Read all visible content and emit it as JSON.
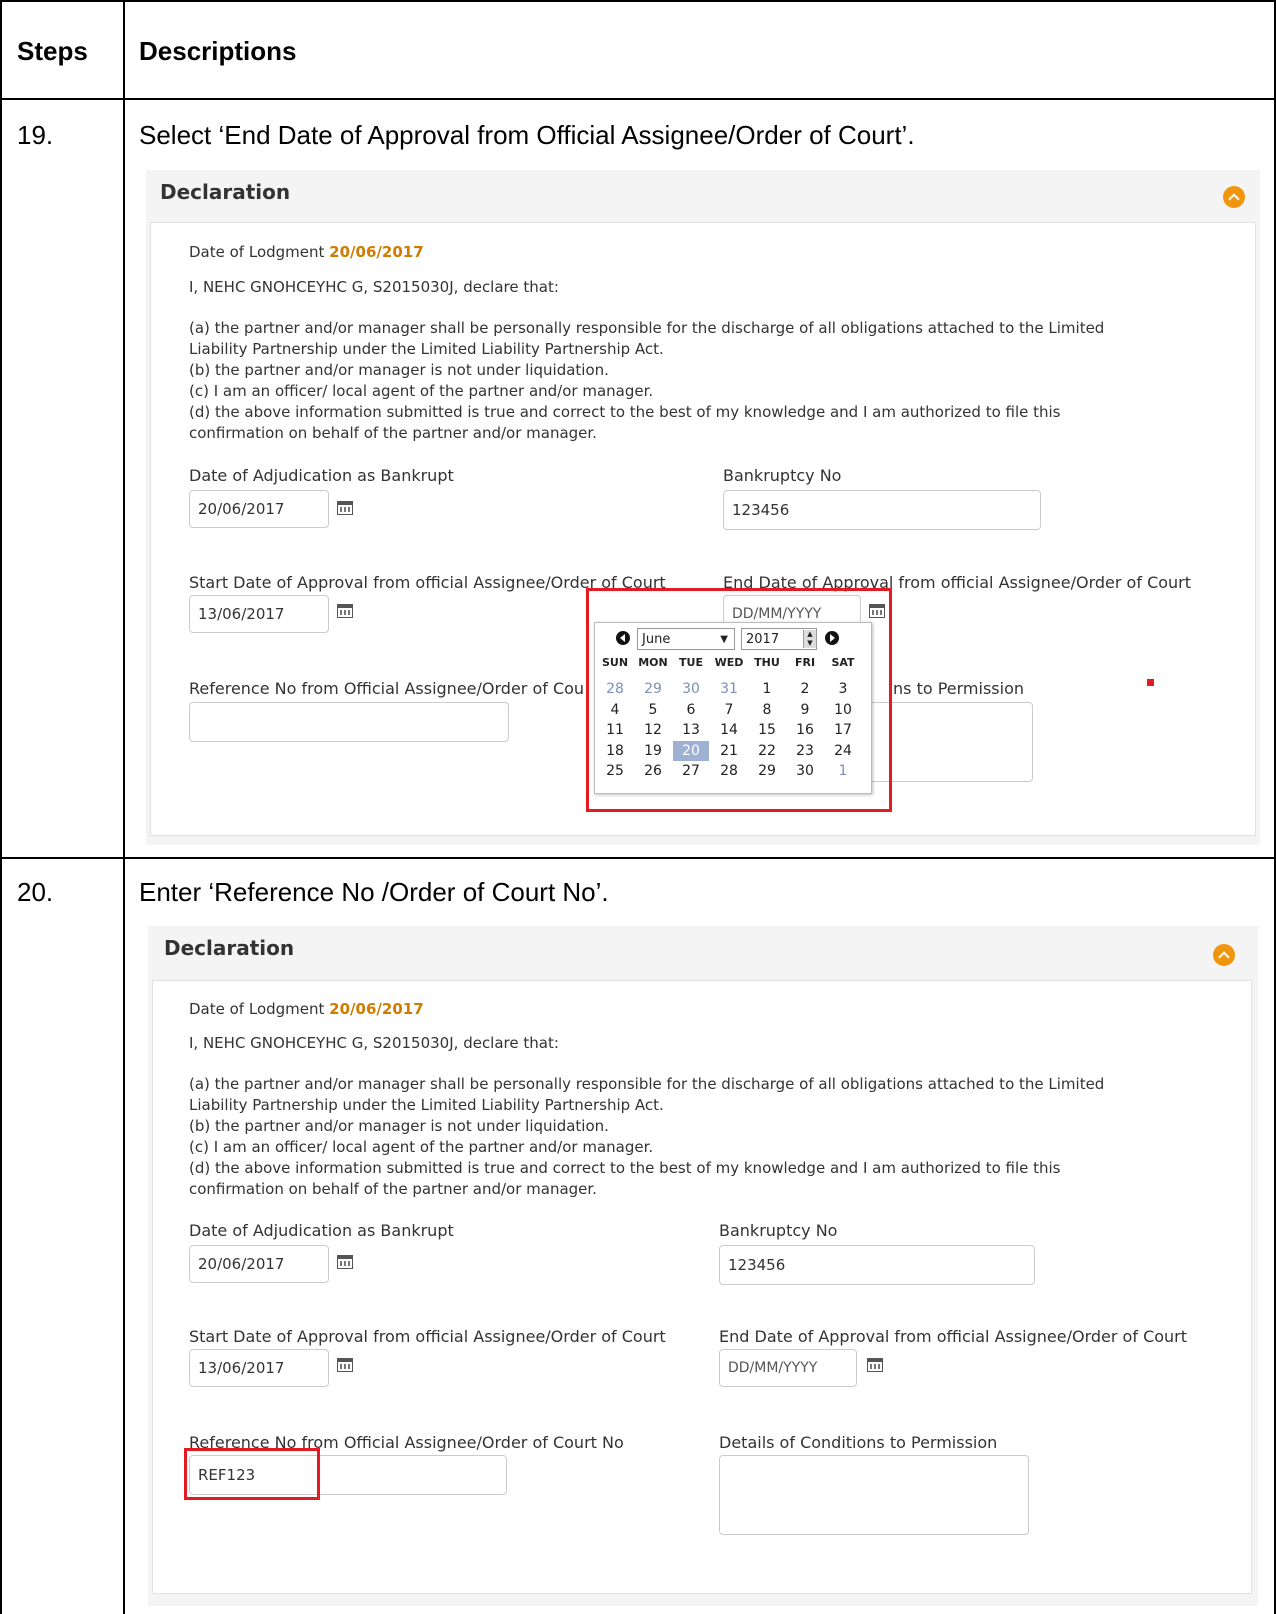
{
  "table": {
    "header_steps": "Steps",
    "header_descriptions": "Descriptions"
  },
  "steps": [
    {
      "number": "19.",
      "description": "Select ‘End Date of Approval from Official Assignee/Order of Court’."
    },
    {
      "number": "20.",
      "description": "Enter ‘Reference No /Order of Court No’."
    }
  ],
  "form": {
    "panel_title": "Declaration",
    "lodgment_label": "Date of Lodgment",
    "lodgment_value": "20/06/2017",
    "declare_intro": "I, NEHC GNOHCEYHC G, S2015030J, declare that:",
    "clauses": [
      "(a) the partner and/or manager shall be personally responsible for the discharge of all obligations attached to the Limited",
      "Liability Partnership under the Limited Liability Partnership Act.",
      "(b) the partner and/or manager is not under liquidation.",
      "(c) I am an officer/ local agent of the partner and/or manager.",
      "(d) the above information submitted is true and correct to the best of my knowledge and I am authorized to file this",
      "confirmation on behalf of the partner and/or manager."
    ],
    "adjudication_label": "Date of Adjudication as Bankrupt",
    "adjudication_value": "20/06/2017",
    "bankruptcy_label": "Bankruptcy No",
    "bankruptcy_value": "123456",
    "start_label": "Start Date of Approval from official Assignee/Order of Court",
    "start_value": "13/06/2017",
    "end_label": "End Date of Approval from official Assignee/Order of Court",
    "end_placeholder": "DD/MM/YYYY",
    "reference_label": "Reference No from Official Assignee/Order of Court No",
    "reference_label_truncated": "Reference No from Official Assignee/Order of Cou",
    "conditions_label": "Details of Conditions to Permission",
    "conditions_label_truncated": "ns to Permission",
    "reference_value_step20": "REF123"
  },
  "calendar": {
    "month": "June",
    "year": "2017",
    "weekdays": [
      "SUN",
      "MON",
      "TUE",
      "WED",
      "THU",
      "FRI",
      "SAT"
    ],
    "weeks": [
      [
        "28",
        "29",
        "30",
        "31",
        "1",
        "2",
        "3"
      ],
      [
        "4",
        "5",
        "6",
        "7",
        "8",
        "9",
        "10"
      ],
      [
        "11",
        "12",
        "13",
        "14",
        "15",
        "16",
        "17"
      ],
      [
        "18",
        "19",
        "20",
        "21",
        "22",
        "23",
        "24"
      ],
      [
        "25",
        "26",
        "27",
        "28",
        "29",
        "30",
        "1"
      ]
    ],
    "today": "20"
  },
  "colors": {
    "accent_orange": "#d07b00",
    "highlight_red": "#e31b23",
    "today_bg": "#9fb1d3"
  }
}
